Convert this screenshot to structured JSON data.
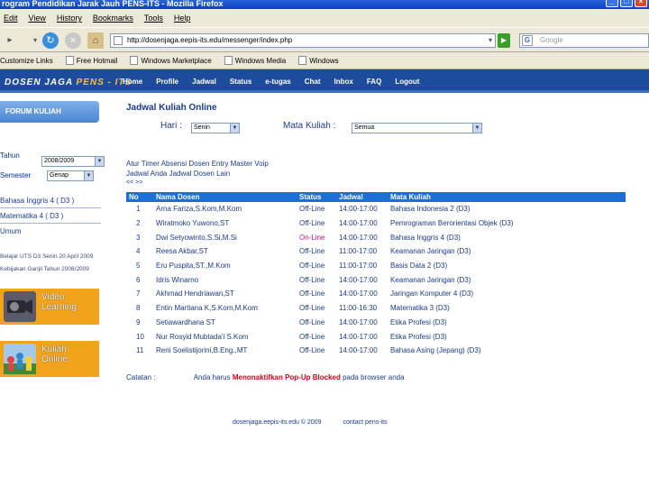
{
  "window": {
    "title": "rogram Pendidikan Jarak Jauh PENS-ITS - Mozilla Firefox"
  },
  "menu": [
    "Edit",
    "View",
    "History",
    "Bookmarks",
    "Tools",
    "Help"
  ],
  "nav": {
    "url": "http://dosenjaga.eepis-its.edu/messenger/index.php",
    "search_placeholder": "Google"
  },
  "bookmarks": [
    "Customize Links",
    "Free Hotmail",
    "Windows Marketplace",
    "Windows Media",
    "Windows"
  ],
  "site": {
    "logo_main": "DOSEN JAGA ",
    "logo_accent": "PENS - ITS",
    "nav": [
      "Home",
      "Profile",
      "Jadwal",
      "Status",
      "e-tugas",
      "Chat",
      "Inbox",
      "FAQ",
      "Logout"
    ]
  },
  "sidebar": {
    "forum": "FORUM KULIAH",
    "tahun_label": "Tahun",
    "tahun_value": "2008/2009",
    "semester_label": "Semester",
    "semester_value": "Genap",
    "links": [
      "Bahasa Inggris 4 ( D3 )",
      "Matematika 4 ( D3 )",
      "Umum"
    ],
    "small1": "Belajar UTS D3 Senin 20 April 2009",
    "small2": "Kebijakan Ganjil Tahun 2008/2009",
    "promo1": "Video Learning",
    "promo2": "Kuliah Online"
  },
  "main": {
    "title": "Jadwal Kuliah Online",
    "hari_label": "Hari :",
    "hari_value": "Senin",
    "mk_label": "Mata Kuliah :",
    "mk_value": "Semua",
    "note1": "Atur Timer Absensi Dosen Entry Master Voip",
    "note2": "Jadwal Anda Jadwal Dosen Lain",
    "note3": "<< >>",
    "headers": [
      "No",
      "Nama Dosen",
      "Status",
      "Jadwal",
      "Mata Kuliah"
    ],
    "rows": [
      [
        "1",
        "Arna Fariza,S.Kom,M.Kom",
        "Off-Line",
        "14:00-17:00",
        "Bahasa Indonesia 2 (D3)"
      ],
      [
        "2",
        "Wiratmoko Yuwono,ST",
        "Off-Line",
        "14:00-17:00",
        "Pemrograman Berorientasi Objek (D3)"
      ],
      [
        "3",
        "Dwi Setyowinto,S.Si,M.Si",
        "On-Line",
        "14:00-17:00",
        "Bahasa Inggris 4 (D3)"
      ],
      [
        "4",
        "Reesa Akbar,ST",
        "Off-Line",
        "11:00-17:00",
        "Keamanan Jaringan (D3)"
      ],
      [
        "5",
        "Eru Puspita,ST.,M.Kom",
        "Off-Line",
        "11:00-17:00",
        "Basis Data 2 (D3)"
      ],
      [
        "6",
        "Idris Winarno",
        "Off-Line",
        "14:00-17:00",
        "Keamanan Jaringan (D3)"
      ],
      [
        "7",
        "Akhmad Hendriawan,ST",
        "Off-Line",
        "14:00-17:00",
        "Jaringan Komputer 4 (D3)"
      ],
      [
        "8",
        "Entin Martiana K,S.Kom,M.Kom",
        "Off-Line",
        "11:00-16:30",
        "Matematika 3 (D3)"
      ],
      [
        "9",
        "Setiawardhana ST",
        "Off-Line",
        "14:00-17:00",
        "Etika Profesi (D3)"
      ],
      [
        "10",
        "Nur Rosyid Mubtada'i S.Kom",
        "Off-Line",
        "14:00-17:00",
        "Etika Profesi (D3)"
      ],
      [
        "11",
        "Reni Soelistijorini,B.Eng.,MT",
        "Off-Line",
        "14:00-17:00",
        "Bahasa Asing (Jepang) (D3)"
      ]
    ],
    "catatan_label": "Catatan :",
    "catatan_pre": "Anda harus ",
    "catatan_bold": "Menonaktifkan Pop-Up Blocked",
    "catatan_post": " pada browser anda"
  },
  "footer": {
    "domain": "dosenjaga.eepis-its.edu © 2009",
    "contact": "contact pens-its"
  }
}
